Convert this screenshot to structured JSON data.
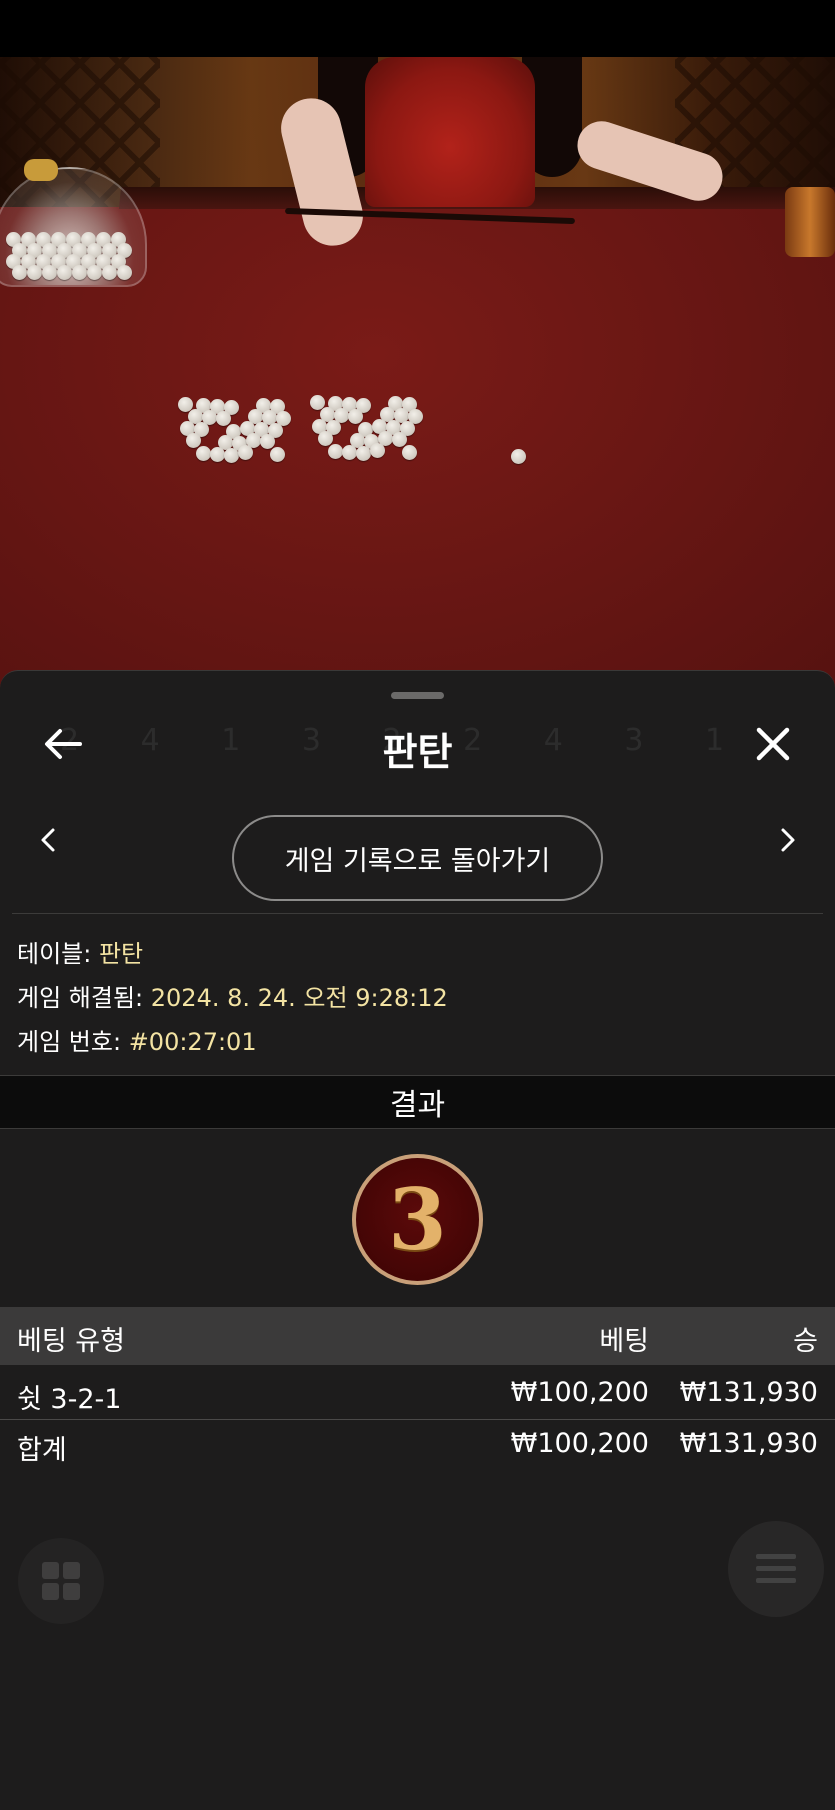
{
  "header": {
    "title": "판탄",
    "back_icon": "arrow-left-icon",
    "close_icon": "close-icon"
  },
  "nav": {
    "history_button_label": "게임 기록으로 돌아가기",
    "prev_icon": "chevron-left-icon",
    "next_icon": "chevron-right-icon"
  },
  "info": {
    "table_label": "테이블:",
    "table_value": "판탄",
    "resolved_label": "게임 해결됨:",
    "resolved_value": "2024. 8. 24. 오전 9:28:12",
    "game_no_label": "게임 번호:",
    "game_no_value": "#00:27:01"
  },
  "result": {
    "heading": "결과",
    "value": "3"
  },
  "bets": {
    "columns": [
      "베팅 유형",
      "베팅",
      "승"
    ],
    "rows": [
      {
        "type": "쉿 3-2-1",
        "bet": "₩100,200",
        "win": "₩131,930"
      }
    ],
    "total": {
      "type": "합계",
      "bet": "₩100,200",
      "win": "₩131,930"
    }
  },
  "colors": {
    "accent_value": "#f3e3a3",
    "sheet_bg": "#1d1c1c",
    "result_ring": "#c9a079",
    "result_fill": "#3a0303"
  }
}
